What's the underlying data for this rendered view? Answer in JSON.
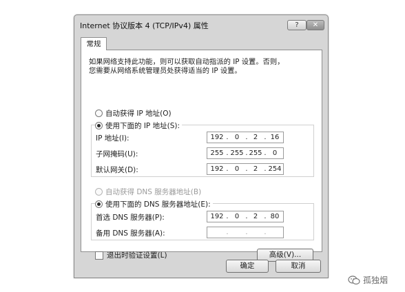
{
  "window": {
    "title": "Internet 协议版本 4 (TCP/IPv4) 属性",
    "help_glyph": "?",
    "close_glyph": "✕"
  },
  "tabs": [
    {
      "label": "常规",
      "active": true
    }
  ],
  "description": [
    "如果网络支持此功能，则可以获取自动指派的 IP 设置。否则，",
    "您需要从网络系统管理员处获得适当的 IP 设置。"
  ],
  "ip_section": {
    "auto_label": "自动获得 IP 地址(O)",
    "manual_label": "使用下面的 IP 地址(S):",
    "selected": "manual",
    "fields": [
      {
        "label": "IP 地址(I):",
        "octets": [
          "192",
          "0",
          "2",
          "16"
        ]
      },
      {
        "label": "子网掩码(U):",
        "octets": [
          "255",
          "255",
          "255",
          "0"
        ]
      },
      {
        "label": "默认网关(D):",
        "octets": [
          "192",
          "0",
          "2",
          "254"
        ]
      }
    ]
  },
  "dns_section": {
    "auto_label": "自动获得 DNS 服务器地址(B)",
    "manual_label": "使用下面的 DNS 服务器地址(E):",
    "selected": "manual",
    "fields": [
      {
        "label": "首选 DNS 服务器(P):",
        "octets": [
          "192",
          "0",
          "2",
          "80"
        ]
      },
      {
        "label": "备用 DNS 服务器(A):",
        "octets": [
          "",
          "",
          "",
          ""
        ]
      }
    ]
  },
  "validate_on_exit": {
    "label": "退出时验证设置(L)",
    "checked": false
  },
  "buttons": {
    "advanced": "高级(V)...",
    "ok": "确定",
    "cancel": "取消"
  },
  "watermark": {
    "text": "孤独烟",
    "icon": "wechat-icon"
  }
}
